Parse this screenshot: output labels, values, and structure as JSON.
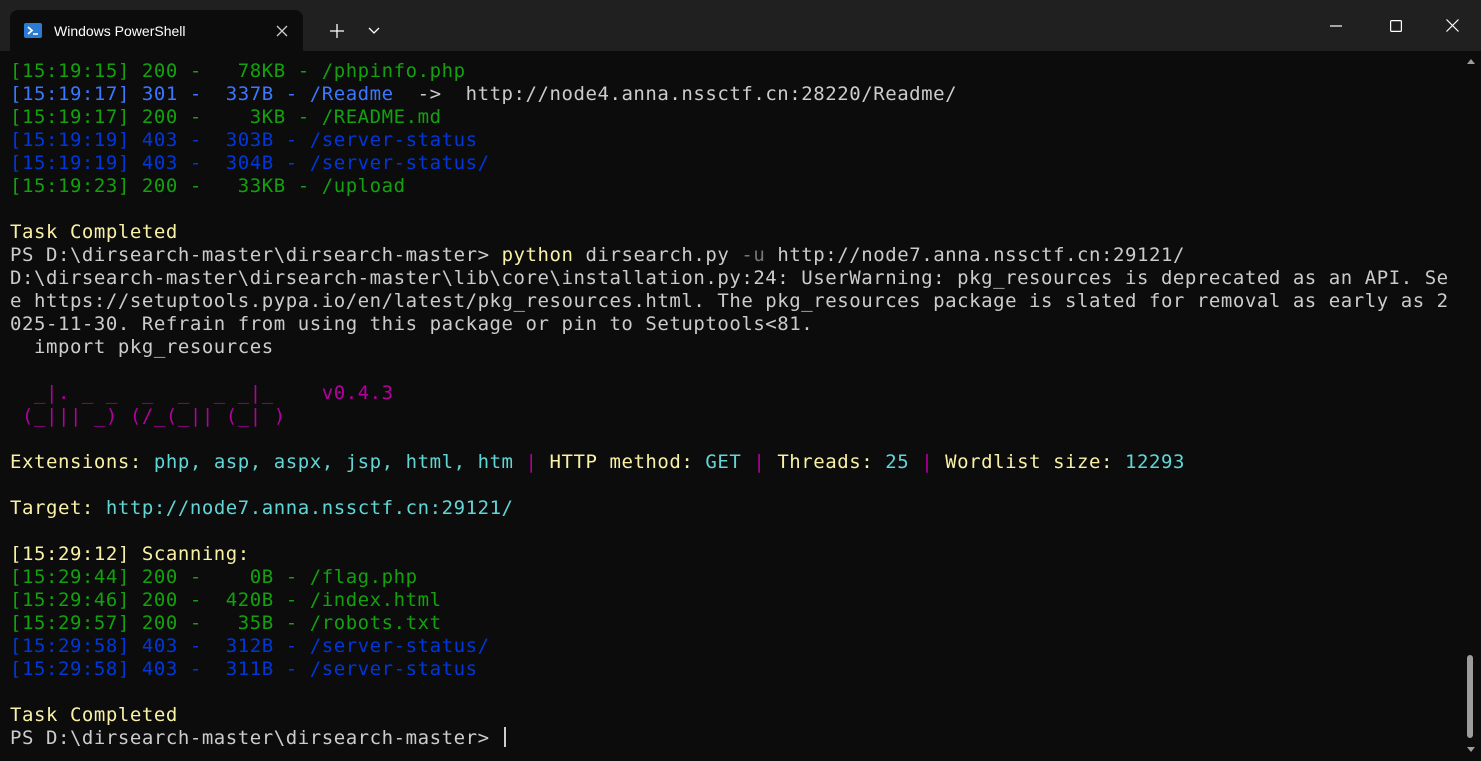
{
  "window": {
    "tab_title": "Windows PowerShell",
    "icons": {
      "tab": "powershell-icon",
      "close_tab": "close-icon",
      "new_tab": "plus-icon",
      "dropdown": "chevron-down-icon",
      "minimize": "minimize-icon",
      "maximize": "maximize-icon",
      "close_window": "close-icon"
    }
  },
  "colors": {
    "background": "#0c0c0c",
    "titlebar": "#202020",
    "green": "#13a10e",
    "blue": "#0037da",
    "light_blue": "#3b78ff",
    "yellow": "#f9f1a5",
    "cyan": "#61d6d6",
    "magenta": "#b4009e",
    "text": "#cccccc"
  },
  "terminal": {
    "scan1": [
      {
        "ts": "[15:19:15] 200 -   78KB - /phpinfo.php"
      },
      {
        "ts": "[15:19:17] 301 -  337B - /Readme",
        "redirect": "  ->  http://node4.anna.nssctf.cn:28220/Readme/"
      },
      {
        "ts": "[15:19:17] 200 -    3KB - /README.md"
      },
      {
        "ts": "[15:19:19] 403 -  303B - /server-status"
      },
      {
        "ts": "[15:19:19] 403 -  304B - /server-status/"
      },
      {
        "ts": "[15:19:23] 200 -   33KB - /upload"
      }
    ],
    "task_completed_1": "Task Completed",
    "prompt_1": "PS D:\\dirsearch-master\\dirsearch-master> ",
    "cmd_python": "python",
    "cmd_script": " dirsearch.py ",
    "cmd_flag": "-u",
    "cmd_url": " http://node7.anna.nssctf.cn:29121/",
    "warning_lines": [
      "D:\\dirsearch-master\\dirsearch-master\\lib\\core\\installation.py:24: UserWarning: pkg_resources is deprecated as an API. Se",
      "e https://setuptools.pypa.io/en/latest/pkg_resources.html. The pkg_resources package is slated for removal as early as 2",
      "025-11-30. Refrain from using this package or pin to Setuptools<81.",
      "  import pkg_resources"
    ],
    "banner": [
      "  _|. _ _  _  _  _ _|_    ",
      " (_||| _) (/_(_|| (_| )   "
    ],
    "version": "v0.4.3",
    "ext_label": "Extensions: ",
    "ext_value": "php, asp, aspx, jsp, html, htm",
    "sep": " | ",
    "method_label": "HTTP method: ",
    "method_value": "GET",
    "threads_label": "Threads: ",
    "threads_value": "25",
    "wordlist_label": "Wordlist size: ",
    "wordlist_value": "12293",
    "target_label": "Target: ",
    "target_value": "http://node7.anna.nssctf.cn:29121/",
    "scanning": "[15:29:12] Scanning:",
    "scan2": [
      {
        "ts": "[15:29:44] 200 -    0B - /flag.php"
      },
      {
        "ts": "[15:29:46] 200 -  420B - /index.html"
      },
      {
        "ts": "[15:29:57] 200 -   35B - /robots.txt"
      },
      {
        "ts": "[15:29:58] 403 -  312B - /server-status/"
      },
      {
        "ts": "[15:29:58] 403 -  311B - /server-status"
      }
    ],
    "task_completed_2": "Task Completed",
    "prompt_2": "PS D:\\dirsearch-master\\dirsearch-master> "
  }
}
